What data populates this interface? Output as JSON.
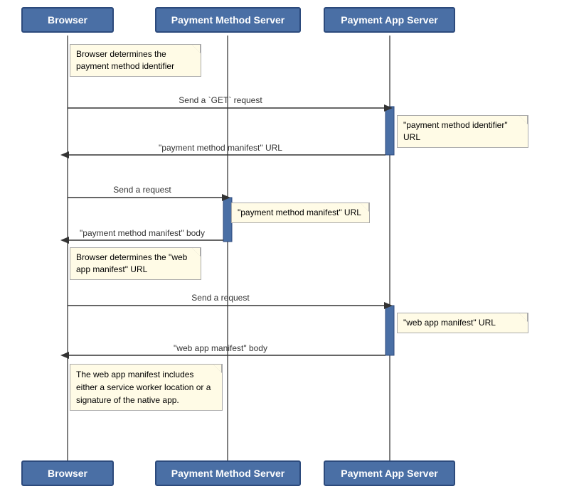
{
  "header": {
    "browser_label": "Browser",
    "payment_method_label": "Payment Method Server",
    "payment_app_label": "Payment App Server"
  },
  "footer": {
    "browser_label": "Browser",
    "payment_method_label": "Payment Method Server",
    "payment_app_label": "Payment App Server"
  },
  "notes": {
    "note1": "Browser determines\nthe payment method identifier",
    "note2": "\"payment method identifier\" URL",
    "note3": "\"payment method manifest\" URL",
    "note4": "Browser determines\nthe \"web app manifest\" URL",
    "note5": "\"web app manifest\" URL",
    "note6": "The web app manifest includes\neither a service worker location or\na signature of the native app."
  },
  "arrows": {
    "get_request": "Send a `GET` request",
    "manifest_url_return": "\"payment method manifest\" URL",
    "send_request": "Send a request",
    "manifest_body_return": "\"payment method manifest\" body",
    "send_request2": "Send a request",
    "web_manifest_body": "\"web app manifest\" body"
  }
}
